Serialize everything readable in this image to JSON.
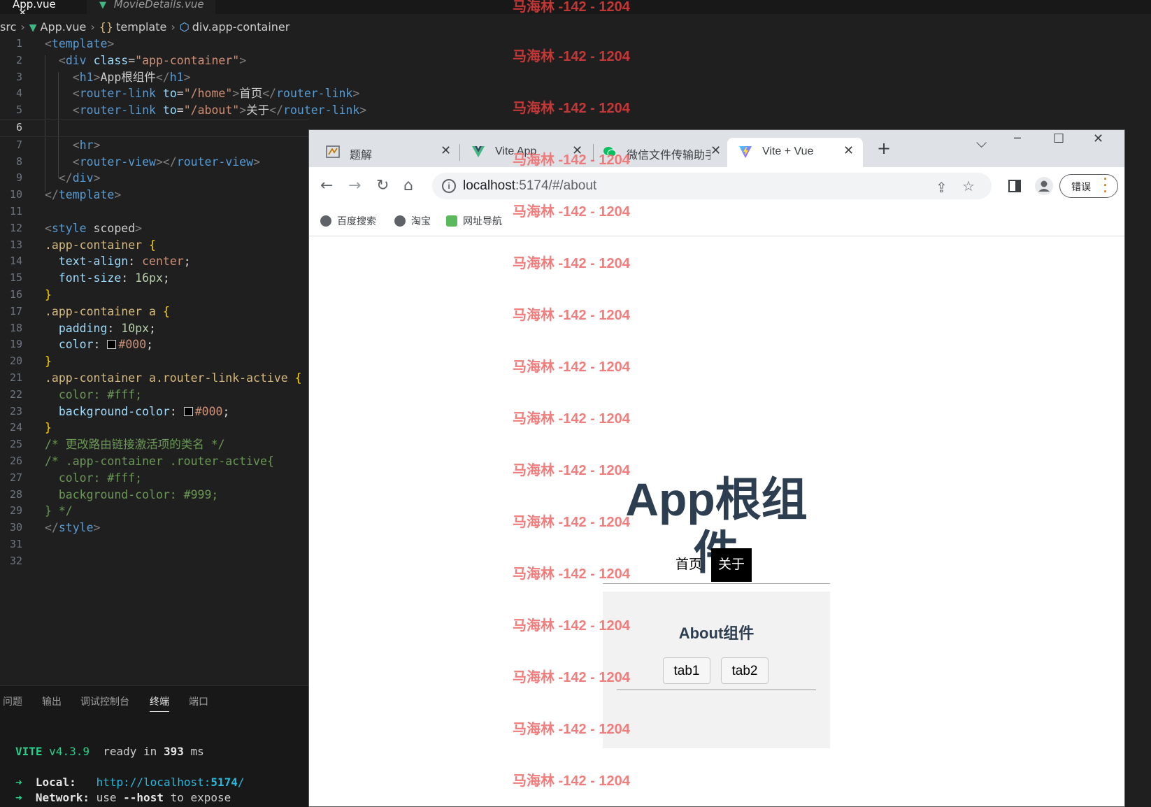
{
  "editor": {
    "tabs": [
      {
        "label": "App.vue",
        "close": "✕"
      },
      {
        "label": "MovieDetails.vue"
      }
    ],
    "breadcrumb": [
      "src",
      "App.vue",
      "template",
      "div.app-container"
    ],
    "code_lines": [
      "<template>",
      "  <div class=\"app-container\">",
      "    <h1>App根组件</h1>",
      "    <router-link to=\"/home\">首页</router-link>",
      "    <router-link to=\"/about\">关于</router-link>",
      "",
      "    <hr>",
      "    <router-view></router-view>",
      "  </div>",
      "</template>",
      "",
      "<style scoped>",
      ".app-container {",
      "  text-align: center;",
      "  font-size: 16px;",
      "}",
      ".app-container a {",
      "  padding: 10px;",
      "  color: #000;",
      "}",
      ".app-container a.router-link-active {",
      "  color: #fff;",
      "  background-color: #000;",
      "}",
      "/* 更改路由链接激活项的类名 */",
      "/* .app-container .router-active{",
      "  color: #fff;",
      "  background-color: #999;",
      "} */",
      "</style>",
      "",
      ""
    ],
    "current_line": 6,
    "colors": {
      "black_swatch": "#000000",
      "white_swatch": "#ffffff"
    }
  },
  "panel": {
    "tabs": [
      "问题",
      "输出",
      "调试控制台",
      "终端",
      "端口"
    ],
    "active_tab": "终端",
    "terminal": {
      "vite_label": "VITE",
      "vite_version": "v4.3.9",
      "ready_text": "ready in",
      "ready_ms": "393",
      "ms_unit": "ms",
      "arrow": "➜",
      "local_label": "Local:",
      "local_url_base": "http://localhost:",
      "local_port": "5174",
      "local_url_tail": "/",
      "network_label": "Network:",
      "network_text_pre": "use",
      "network_flag": "--host",
      "network_text_post": "to expose"
    }
  },
  "browser": {
    "tabs": [
      {
        "label": "题解",
        "close": "✕"
      },
      {
        "label": "Vite App",
        "close": "✕"
      },
      {
        "label": "微信文件传输助手",
        "close": "✕"
      },
      {
        "label": "Vite + Vue",
        "close": "✕",
        "active": true
      }
    ],
    "new_tab": "+",
    "window_controls": {
      "menu": "⌵",
      "minimize": "─",
      "maximize": "☐",
      "close": "✕"
    },
    "url_host": "localhost",
    "url_rest": ":5174/#/about",
    "info_glyph": "i",
    "error_button": "错误",
    "bookmarks": [
      "百度搜索",
      "淘宝",
      "网址导航"
    ],
    "accent_color": "#e37400"
  },
  "app": {
    "title": "App根组件",
    "links": [
      {
        "label": "首页",
        "active": false
      },
      {
        "label": "关于",
        "active": true
      }
    ],
    "about": {
      "title": "About组件",
      "tabs": [
        "tab1",
        "tab2"
      ]
    }
  },
  "watermark": {
    "text": "马海林 -142 - 1204"
  }
}
